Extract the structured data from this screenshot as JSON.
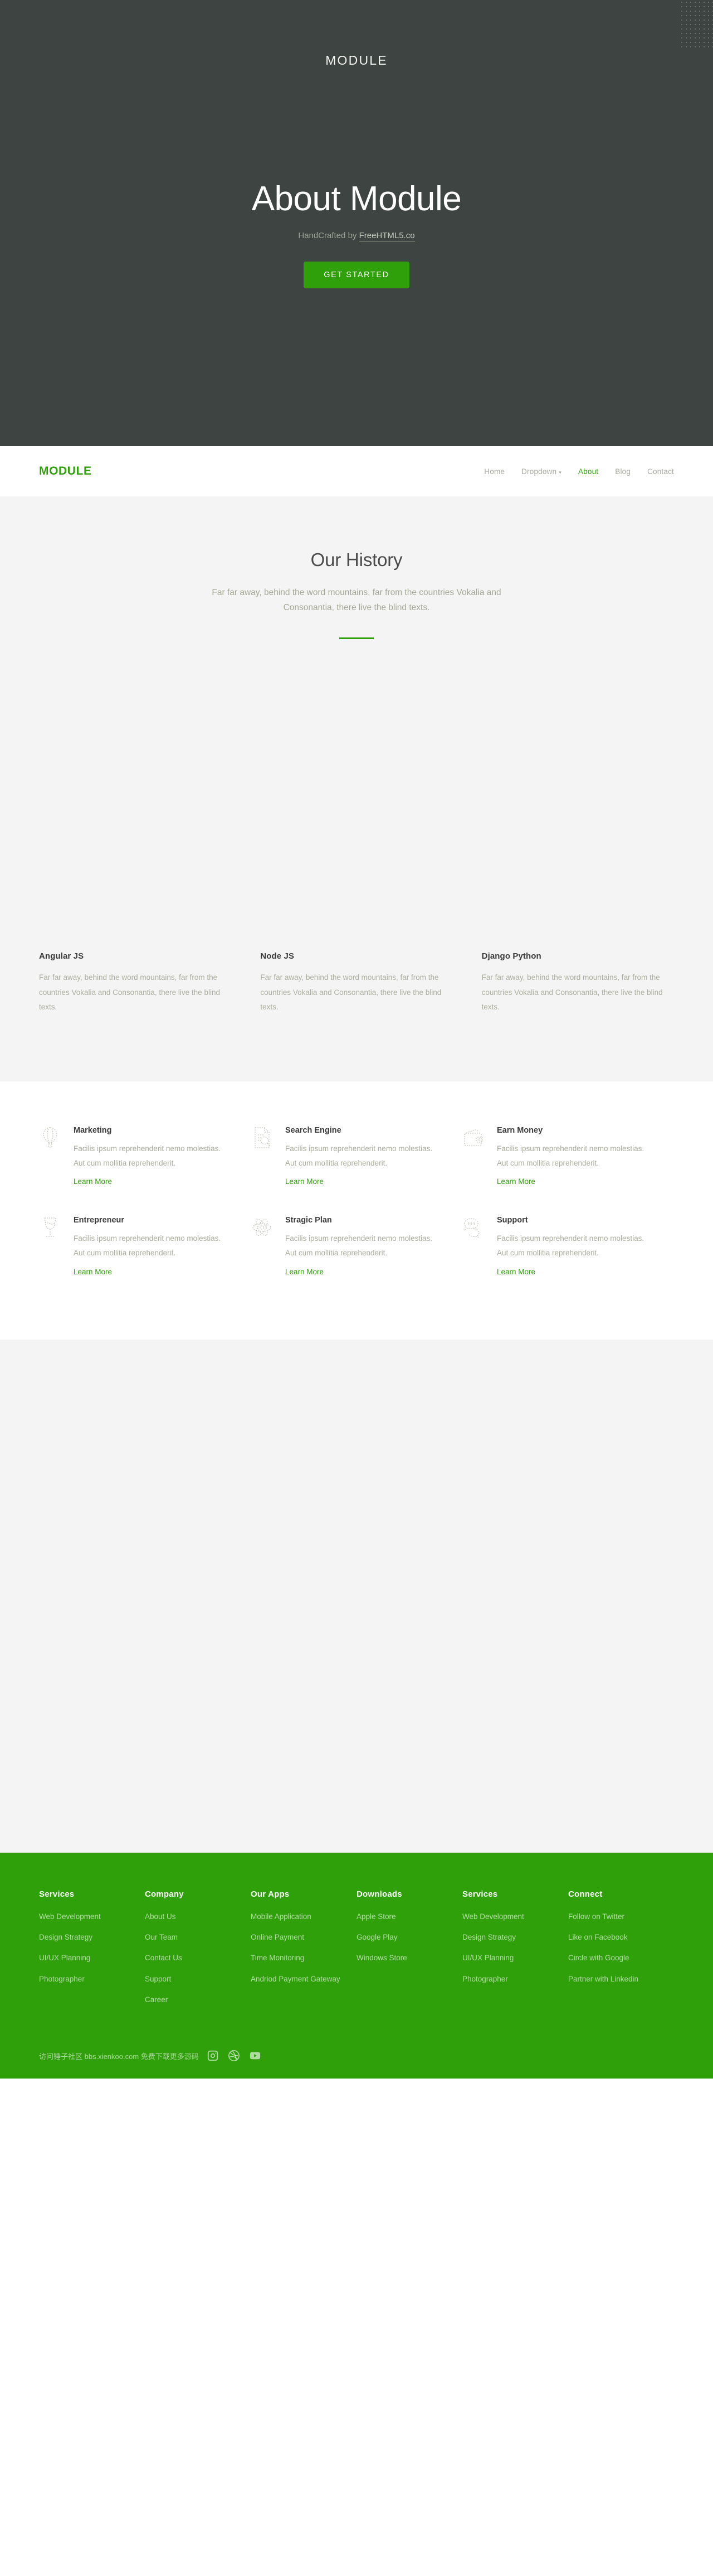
{
  "hero": {
    "brand": "MODULE",
    "title": "About Module",
    "subtitle_prefix": "HandCrafted by ",
    "subtitle_link": "FreeHTML5.co",
    "cta_label": "GET STARTED",
    "bg_color": "#3e4441",
    "accent_color": "#2fa00a"
  },
  "nav": {
    "logo": "MODULE",
    "items": [
      {
        "label": "Home",
        "active": false,
        "dropdown": false
      },
      {
        "label": "Dropdown",
        "active": false,
        "dropdown": true
      },
      {
        "label": "About",
        "active": true,
        "dropdown": false
      },
      {
        "label": "Blog",
        "active": false,
        "dropdown": false
      },
      {
        "label": "Contact",
        "active": false,
        "dropdown": false
      }
    ]
  },
  "history": {
    "heading": "Our History",
    "intro": "Far far away, behind the word mountains, far from the countries Vokalia and Consonantia, there live the blind texts.",
    "columns": [
      {
        "title": "Angular JS",
        "text": "Far far away, behind the word mountains, far from the countries Vokalia and Consonantia, there live the blind texts."
      },
      {
        "title": "Node JS",
        "text": "Far far away, behind the word mountains, far from the countries Vokalia and Consonantia, there live the blind texts."
      },
      {
        "title": "Django Python",
        "text": "Far far away, behind the word mountains, far from the countries Vokalia and Consonantia, there live the blind texts."
      }
    ]
  },
  "services": {
    "items": [
      {
        "icon": "hot-air-balloon-icon",
        "title": "Marketing",
        "text": "Facilis ipsum reprehenderit nemo molestias. Aut cum mollitia reprehenderit.",
        "link": "Learn More"
      },
      {
        "icon": "document-search-icon",
        "title": "Search Engine",
        "text": "Facilis ipsum reprehenderit nemo molestias. Aut cum mollitia reprehenderit.",
        "link": "Learn More"
      },
      {
        "icon": "wallet-icon",
        "title": "Earn Money",
        "text": "Facilis ipsum reprehenderit nemo molestias. Aut cum mollitia reprehenderit.",
        "link": "Learn More"
      },
      {
        "icon": "wine-glass-icon",
        "title": "Entrepreneur",
        "text": "Facilis ipsum reprehenderit nemo molestias. Aut cum mollitia reprehenderit.",
        "link": "Learn More"
      },
      {
        "icon": "atom-icon",
        "title": "Stragic Plan",
        "text": "Facilis ipsum reprehenderit nemo molestias. Aut cum mollitia reprehenderit.",
        "link": "Learn More"
      },
      {
        "icon": "speech-bubbles-icon",
        "title": "Support",
        "text": "Facilis ipsum reprehenderit nemo molestias. Aut cum mollitia reprehenderit.",
        "link": "Learn More"
      }
    ]
  },
  "footer": {
    "bg_color": "#2fa00a",
    "columns": [
      {
        "heading": "Services",
        "links": [
          "Web Development",
          "Design Strategy",
          "UI/UX Planning",
          "Photographer"
        ]
      },
      {
        "heading": "Company",
        "links": [
          "About Us",
          "Our Team",
          "Contact Us",
          "Support",
          "Career"
        ]
      },
      {
        "heading": "Our Apps",
        "links": [
          "Mobile Application",
          "Online Payment",
          "Time Monitoring",
          "Andriod Payment Gateway"
        ]
      },
      {
        "heading": "Downloads",
        "links": [
          "Apple Store",
          "Google Play",
          "Windows Store"
        ]
      },
      {
        "heading": "Services",
        "links": [
          "Web Development",
          "Design Strategy",
          "UI/UX Planning",
          "Photographer"
        ]
      },
      {
        "heading": "Connect",
        "links": [
          "Follow on Twitter",
          "Like on Facebook",
          "Circle with Google",
          "Partner with Linkedin"
        ]
      }
    ],
    "copyright": "访问锤子社区 bbs.xienkoo.com 免费下载更多源码",
    "socials": [
      "instagram-icon",
      "dribbble-icon",
      "youtube-icon"
    ]
  }
}
